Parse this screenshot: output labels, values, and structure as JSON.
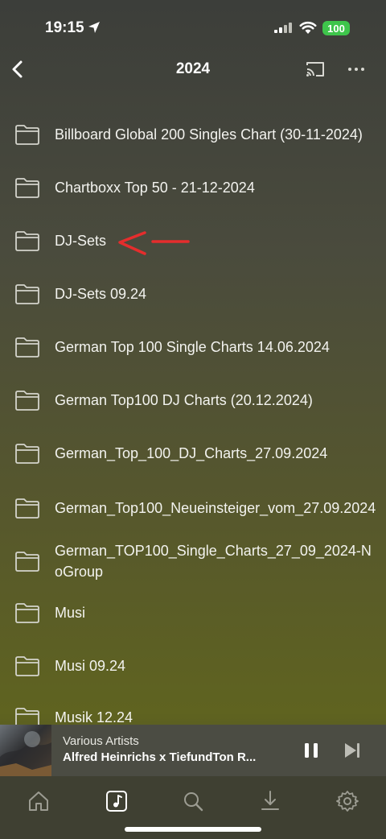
{
  "status": {
    "time": "19:15",
    "battery": "100"
  },
  "header": {
    "title": "2024"
  },
  "folders": [
    {
      "label": "Billboard Global 200 Singles Chart (30-11-2024)"
    },
    {
      "label": "Chartboxx Top 50 - 21-12-2024"
    },
    {
      "label": "DJ-Sets"
    },
    {
      "label": "DJ-Sets 09.24"
    },
    {
      "label": "German Top 100 Single Charts 14.06.2024"
    },
    {
      "label": "German Top100 DJ Charts (20.12.2024)"
    },
    {
      "label": "German_Top_100_DJ_Charts_27.09.2024"
    },
    {
      "label": "German_Top100_Neueinsteiger_vom_27.09.2024"
    },
    {
      "label": "German_TOP100_Single_Charts_27_09_2024-NoGroup"
    },
    {
      "label": "Musi"
    },
    {
      "label": "Musi 09.24"
    },
    {
      "label": "Musik 12.24"
    }
  ],
  "player": {
    "artist": "Various Artists",
    "track": "Alfred Heinrichs  x TiefundTon  R..."
  },
  "tabs": [
    "home-icon",
    "music-note-icon",
    "search-icon",
    "download-icon",
    "gear-icon"
  ],
  "colors": {
    "annotation": "#e52d2d",
    "battery": "#3ec54b"
  }
}
